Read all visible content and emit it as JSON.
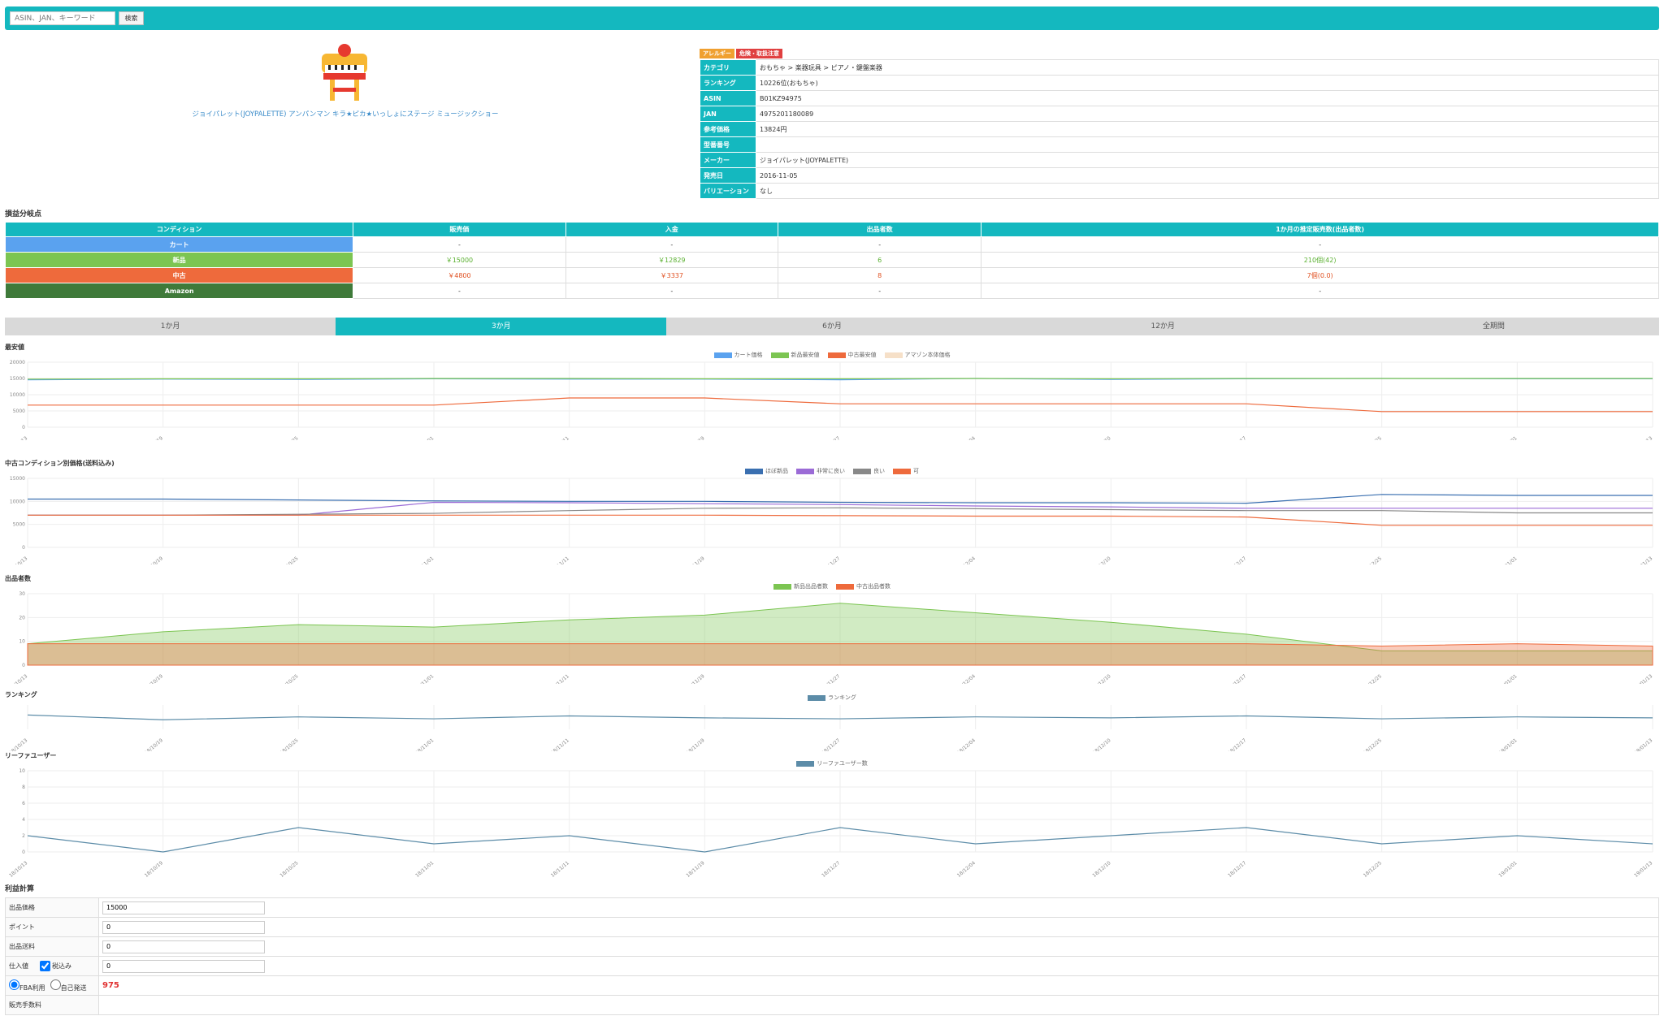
{
  "search": {
    "placeholder": "ASIN、JAN、キーワード",
    "button": "検索"
  },
  "product": {
    "title": "ジョイパレット(JOYPALETTE) アンパンマン キラ★ピカ★いっしょにステージ ミュージックショー",
    "badges": [
      {
        "label": "アレルギー",
        "color": "#f0a030"
      },
      {
        "label": "危険・取扱注意",
        "color": "#e04040"
      }
    ],
    "info": [
      {
        "k": "カテゴリ",
        "v": "おもちゃ > 楽器玩具 > ピアノ・鍵盤楽器"
      },
      {
        "k": "ランキング",
        "v": "10226位(おもちゃ)"
      },
      {
        "k": "ASIN",
        "v": "B01KZ94975"
      },
      {
        "k": "JAN",
        "v": "4975201180089"
      },
      {
        "k": "参考価格",
        "v": "13824円"
      },
      {
        "k": "型番番号",
        "v": ""
      },
      {
        "k": "メーカー",
        "v": "ジョイパレット(JOYPALETTE)"
      },
      {
        "k": "発売日",
        "v": "2016-11-05"
      },
      {
        "k": "バリエーション",
        "v": "なし"
      }
    ]
  },
  "breakeven": {
    "title": "損益分岐点",
    "headers": [
      "コンディション",
      "販売価",
      "入金",
      "出品者数",
      "1か月の推定販売数(出品者数)"
    ],
    "rows": [
      {
        "cond": "カート",
        "color": "#5aa2ef",
        "c1": "-",
        "c2": "-",
        "c3": "-",
        "c4": "-",
        "textColor": "#333"
      },
      {
        "cond": "新品",
        "color": "#7cc552",
        "c1": "￥15000",
        "c2": "￥12829",
        "c3": "6",
        "c4": "210個(42)",
        "textColor": "#5ab030"
      },
      {
        "cond": "中古",
        "color": "#ee6a3c",
        "c1": "￥4800",
        "c2": "￥3337",
        "c3": "8",
        "c4": "7個(0.0)",
        "textColor": "#e05020"
      },
      {
        "cond": "Amazon",
        "color": "#3f7a3a",
        "c1": "-",
        "c2": "-",
        "c3": "-",
        "c4": "-",
        "textColor": "#333"
      }
    ]
  },
  "tabs": [
    "1か月",
    "3か月",
    "6か月",
    "12か月",
    "全期間"
  ],
  "active_tab": 1,
  "dates": [
    "18/10/13",
    "18/10/19",
    "18/10/25",
    "18/11/01",
    "18/11/11",
    "18/11/19",
    "18/11/27",
    "18/12/04",
    "18/12/10",
    "18/12/17",
    "18/12/25",
    "19/01/01",
    "19/01/13"
  ],
  "chart_data": [
    {
      "type": "line",
      "title": "最安値",
      "ylim": [
        0,
        20000
      ],
      "yticks": [
        "0",
        "5000",
        "10000",
        "15000",
        "20000"
      ],
      "legend": [
        "カート価格",
        "新品最安値",
        "中古最安値",
        "アマゾン本体価格"
      ],
      "series": [
        {
          "name": "カート価格",
          "color": "#5aa2ef",
          "values": [
            14600,
            14800,
            14700,
            14900,
            14800,
            14800,
            14600,
            15000,
            14700,
            14900,
            15000,
            14900,
            14900
          ]
        },
        {
          "name": "新品最安値",
          "color": "#7cc552",
          "values": [
            14800,
            14900,
            14900,
            15000,
            15000,
            14900,
            14900,
            15000,
            14900,
            15000,
            15000,
            15000,
            15000
          ]
        },
        {
          "name": "中古最安値",
          "color": "#ee6a3c",
          "values": [
            6800,
            6800,
            6800,
            6800,
            9000,
            9000,
            7200,
            7200,
            7200,
            7200,
            4800,
            4800,
            4800
          ]
        }
      ]
    },
    {
      "type": "line",
      "title": "中古コンディション別価格(送料込み)",
      "ylim": [
        0,
        15000
      ],
      "yticks": [
        "0",
        "5000",
        "10000",
        "15000"
      ],
      "legend": [
        "ほぼ新品",
        "非常に良い",
        "良い",
        "可"
      ],
      "series": [
        {
          "name": "ほぼ新品",
          "color": "#3a6fb0",
          "values": [
            10500,
            10500,
            10300,
            10100,
            10000,
            10000,
            9800,
            9700,
            9700,
            9600,
            11500,
            11300,
            11300
          ]
        },
        {
          "name": "非常に良い",
          "color": "#9b6bd6",
          "values": [
            7000,
            7000,
            7000,
            9800,
            9700,
            9500,
            9300,
            9000,
            8800,
            8500,
            8500,
            8500,
            8500
          ]
        },
        {
          "name": "良い",
          "color": "#888888",
          "values": [
            7000,
            7000,
            7200,
            7400,
            8000,
            8500,
            8600,
            8400,
            8200,
            8000,
            8000,
            7500,
            7500
          ]
        },
        {
          "name": "可",
          "color": "#ee6a3c",
          "values": [
            7000,
            7000,
            7000,
            7000,
            7000,
            7000,
            6900,
            6800,
            6800,
            6600,
            4800,
            4800,
            4800
          ]
        }
      ]
    },
    {
      "type": "area",
      "title": "出品者数",
      "ylim": [
        0,
        30
      ],
      "yticks": [
        "0",
        "10",
        "20",
        "30"
      ],
      "legend": [
        "新品出品者数",
        "中古出品者数"
      ],
      "series": [
        {
          "name": "新品出品者数",
          "color": "#7cc552",
          "values": [
            9,
            14,
            17,
            16,
            19,
            21,
            26,
            22,
            18,
            13,
            6,
            6,
            6
          ]
        },
        {
          "name": "中古出品者数",
          "color": "#ee6a3c",
          "values": [
            9,
            9,
            9,
            9,
            9,
            9,
            9,
            9,
            9,
            9,
            8,
            9,
            8
          ]
        }
      ]
    },
    {
      "type": "line",
      "title": "ランキング",
      "legend": [
        "ランキング"
      ],
      "series": [
        {
          "name": "ランキング",
          "color": "#5c8ca8",
          "values": [
            10500,
            10000,
            10300,
            10100,
            10400,
            10200,
            10100,
            10300,
            10200,
            10400,
            10100,
            10300,
            10200
          ]
        }
      ]
    },
    {
      "type": "line",
      "title": "リーファユーザー",
      "ylim": [
        0,
        10
      ],
      "yticks": [
        "0",
        "2",
        "4",
        "6",
        "8",
        "10"
      ],
      "legend": [
        "リーファユーザー数"
      ],
      "series": [
        {
          "name": "リーファユーザー数",
          "color": "#5c8ca8",
          "values": [
            2,
            0,
            3,
            1,
            2,
            0,
            3,
            1,
            2,
            3,
            1,
            2,
            1
          ]
        }
      ]
    }
  ],
  "calc": {
    "title": "利益計算",
    "rows": [
      {
        "label": "出品価格",
        "value": "15000"
      },
      {
        "label": "ポイント",
        "value": "0"
      },
      {
        "label": "出品送料",
        "value": "0"
      },
      {
        "label": "仕入値",
        "check": "税込み",
        "value": "0"
      }
    ],
    "radio_fba": "FBA利用",
    "radio_self": "自己発送",
    "fee_value": "975",
    "last_label": "販売手数料"
  }
}
